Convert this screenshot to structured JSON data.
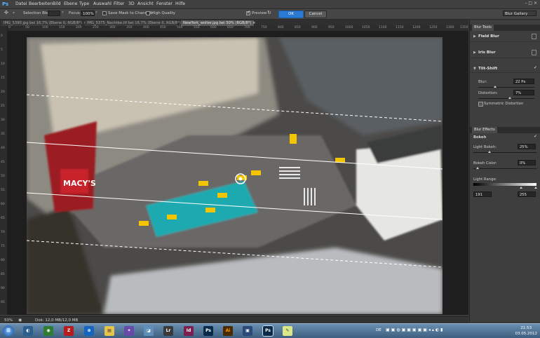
{
  "app": {
    "logo": "Ps"
  },
  "menu": [
    "Datei",
    "Bearbeiten",
    "Bild",
    "Ebene",
    "Type",
    "Auswahl",
    "Filter",
    "3D",
    "Ansicht",
    "Fenster",
    "Hilfe"
  ],
  "window_controls": "– □ ×",
  "options": {
    "selection_bleed_label": "Selection Bleed:",
    "selection_bleed_value": "",
    "focus_label": "Focus:",
    "focus_value": "100%",
    "save_mask_label": "Save Mask to Channels",
    "high_quality_label": "High Quality",
    "preview_label": "Preview",
    "ok_label": "OK",
    "cancel_label": "Cancel",
    "workspace": "Blur Gallery"
  },
  "tabs": [
    {
      "label": "IMG_5390.jpg bei 16,7% (Ebene 0, RGB/8*) ×",
      "active": false
    },
    {
      "label": "IMG_5375_Nachtbe.tif bei 16,7% (Ebene 0, RGB/8*) ×",
      "active": false
    },
    {
      "label": "NewYork_wolter.jpg bei 50% (RGB/8*) ×",
      "active": true
    }
  ],
  "ruler_top": [
    "0",
    "50",
    "100",
    "150",
    "200",
    "250",
    "300",
    "350",
    "400",
    "450",
    "500",
    "550",
    "600",
    "650",
    "700",
    "750",
    "800",
    "850",
    "900",
    "950",
    "1000",
    "1050",
    "1100",
    "1150",
    "1200",
    "1250",
    "1300",
    "1350"
  ],
  "ruler_left": [
    "0",
    "5",
    "10",
    "15",
    "20",
    "25",
    "30",
    "35",
    "40",
    "45",
    "50",
    "55",
    "60",
    "65",
    "70",
    "75",
    "80",
    "85",
    "90",
    "95"
  ],
  "status": {
    "zoom": "50%",
    "doc": "Dok: 12,0 MB/12,0 MB"
  },
  "panel": {
    "tools_tab": "Blur Tools",
    "field_blur": "Field Blur",
    "iris_blur": "Iris Blur",
    "tilt_shift": "Tilt-Shift",
    "blur_label": "Blur:",
    "blur_value": "22 Px",
    "distortion_label": "Distortion:",
    "distortion_value": "7%",
    "symmetric_label": "Symmetric Distortion",
    "effects_tab": "Blur Effects",
    "bokeh_label": "Bokeh",
    "light_bokeh_label": "Light Bokeh:",
    "light_bokeh_value": "25%",
    "bokeh_color_label": "Bokeh Color:",
    "bokeh_color_value": "0%",
    "light_range_label": "Light Range:",
    "light_range_min": "191",
    "light_range_max": "255"
  },
  "clock": {
    "time": "21:53",
    "date": "03.05.2012"
  },
  "tray_lang": "DE"
}
